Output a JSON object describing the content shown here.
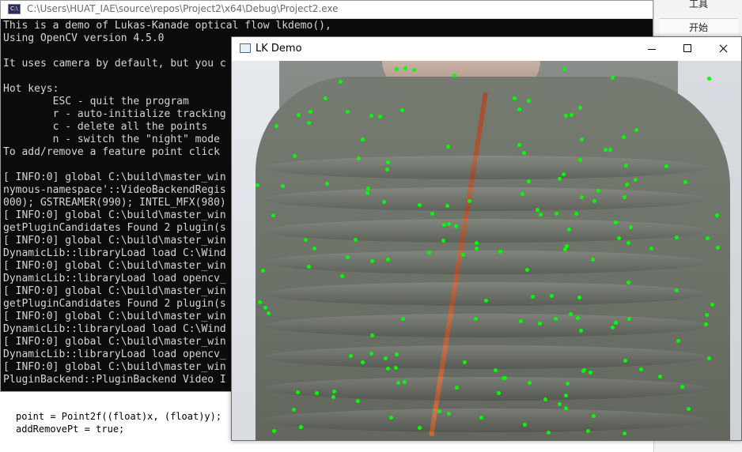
{
  "console": {
    "icon_label": "C:\\",
    "title": "C:\\Users\\HUAT_IAE\\source\\repos\\Project2\\x64\\Debug\\Project2.exe",
    "lines": [
      "This is a demo of Lukas-Kanade optical flow lkdemo(),",
      "Using OpenCV version 4.5.0",
      "",
      "It uses camera by default, but you c",
      "",
      "Hot keys:",
      "        ESC - quit the program",
      "        r - auto-initialize tracking",
      "        c - delete all the points",
      "        n - switch the \"night\" mode",
      "To add/remove a feature point click",
      "",
      "[ INFO:0] global C:\\build\\master_win",
      "nymous-namespace'::VideoBackendRegis",
      "000); GSTREAMER(990); INTEL_MFX(980)",
      "[ INFO:0] global C:\\build\\master_win",
      "getPluginCandidates Found 2 plugin(s",
      "[ INFO:0] global C:\\build\\master_win",
      "DynamicLib::libraryLoad load C:\\Wind",
      "[ INFO:0] global C:\\build\\master_win",
      "DynamicLib::libraryLoad load opencv_",
      "[ INFO:0] global C:\\build\\master_win",
      "getPluginCandidates Found 2 plugin(s",
      "[ INFO:0] global C:\\build\\master_win",
      "DynamicLib::libraryLoad load C:\\Wind",
      "[ INFO:0] global C:\\build\\master_win",
      "DynamicLib::libraryLoad load opencv_",
      "[ INFO:0] global C:\\build\\master_win",
      "PluginBackend::PluginBackend Video I"
    ]
  },
  "editor": {
    "lines": [
      "point = Point2f((float)x, (float)y);",
      "addRemovePt = true;"
    ]
  },
  "side_panel": {
    "items": [
      "工具",
      "开始"
    ]
  },
  "lk_window": {
    "title": "LK Demo"
  }
}
